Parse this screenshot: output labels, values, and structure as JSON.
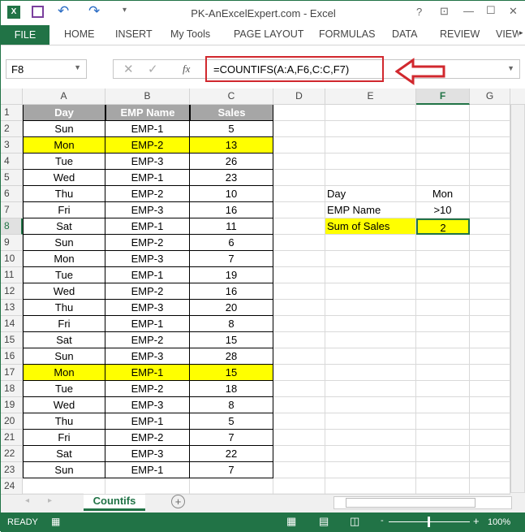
{
  "window": {
    "title": "PK-AnExcelExpert.com - Excel",
    "help": "?",
    "minimize": "—",
    "maximize": "☐",
    "close": "✕"
  },
  "ribbon": {
    "file": "FILE",
    "tabs": [
      "HOME",
      "INSERT",
      "My Tools",
      "PAGE LAYOUT",
      "FORMULAS",
      "DATA",
      "REVIEW",
      "VIEW"
    ]
  },
  "formula_bar": {
    "name_box": "F8",
    "fx": "fx",
    "formula": "=COUNTIFS(A:A,F6,C:C,F7)"
  },
  "columns": [
    "A",
    "B",
    "C",
    "D",
    "E",
    "F",
    "G"
  ],
  "table": {
    "headers": [
      "Day",
      "EMP Name",
      "Sales"
    ],
    "rows": [
      [
        "Sun",
        "EMP-1",
        "5"
      ],
      [
        "Mon",
        "EMP-2",
        "13"
      ],
      [
        "Tue",
        "EMP-3",
        "26"
      ],
      [
        "Wed",
        "EMP-1",
        "23"
      ],
      [
        "Thu",
        "EMP-2",
        "10"
      ],
      [
        "Fri",
        "EMP-3",
        "16"
      ],
      [
        "Sat",
        "EMP-1",
        "11"
      ],
      [
        "Sun",
        "EMP-2",
        "6"
      ],
      [
        "Mon",
        "EMP-3",
        "7"
      ],
      [
        "Tue",
        "EMP-1",
        "19"
      ],
      [
        "Wed",
        "EMP-2",
        "16"
      ],
      [
        "Thu",
        "EMP-3",
        "20"
      ],
      [
        "Fri",
        "EMP-1",
        "8"
      ],
      [
        "Sat",
        "EMP-2",
        "15"
      ],
      [
        "Sun",
        "EMP-3",
        "28"
      ],
      [
        "Mon",
        "EMP-1",
        "15"
      ],
      [
        "Tue",
        "EMP-2",
        "18"
      ],
      [
        "Wed",
        "EMP-3",
        "8"
      ],
      [
        "Thu",
        "EMP-1",
        "5"
      ],
      [
        "Fri",
        "EMP-2",
        "7"
      ],
      [
        "Sat",
        "EMP-3",
        "22"
      ],
      [
        "Sun",
        "EMP-1",
        "7"
      ]
    ],
    "highlighted_rows": [
      3,
      17
    ]
  },
  "criteria": [
    {
      "label": "Day",
      "value": "Mon"
    },
    {
      "label": "EMP Name",
      "value": ">10"
    },
    {
      "label": "Sum of Sales",
      "value": "2"
    }
  ],
  "sheet": {
    "tab": "Countifs",
    "add": "+"
  },
  "status": {
    "ready": "READY",
    "zoom": "100%"
  },
  "colors": {
    "header_fill": "#a6a6a6",
    "highlight": "#ffff00",
    "excel_green": "#217346",
    "annotation_red": "#d1282e"
  }
}
